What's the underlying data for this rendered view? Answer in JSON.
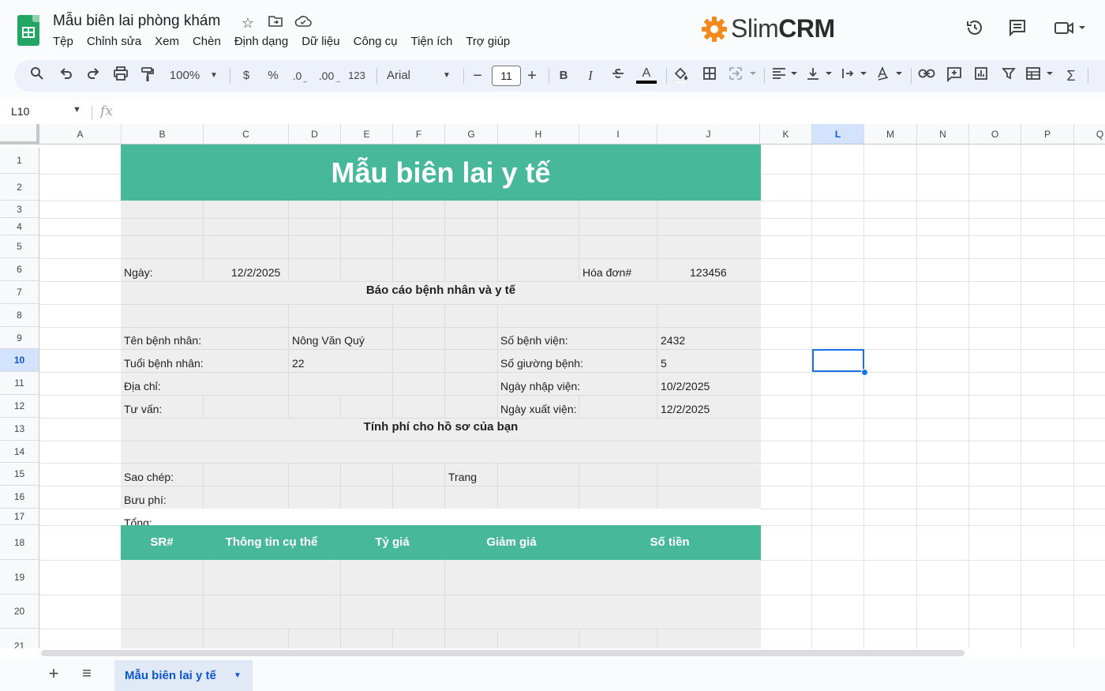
{
  "header": {
    "doc_title": "Mẫu biên lai phòng khám",
    "menus": [
      "Tệp",
      "Chỉnh sửa",
      "Xem",
      "Chèn",
      "Định dạng",
      "Dữ liệu",
      "Công cụ",
      "Tiện ích",
      "Trợ giúp"
    ],
    "brand_prefix": "Slim",
    "brand_bold": "CRM"
  },
  "toolbar": {
    "zoom": "100%",
    "currency": "$",
    "percent": "%",
    "dec_decrease": ".0",
    "dec_increase": ".00",
    "number_format": "123",
    "font": "Arial",
    "font_size": "11",
    "bold": "B",
    "italic": "I",
    "text_color": "A"
  },
  "formula_bar": {
    "cell_ref": "L10",
    "fx": "fx"
  },
  "columns": [
    "A",
    "B",
    "C",
    "D",
    "E",
    "F",
    "G",
    "H",
    "I",
    "J",
    "K",
    "L",
    "M",
    "N",
    "O",
    "P",
    "Q"
  ],
  "selected_column": "L",
  "rows": [
    "1",
    "2",
    "3",
    "4",
    "5",
    "6",
    "7",
    "8",
    "9",
    "10",
    "11",
    "12",
    "13",
    "14",
    "15",
    "16",
    "17",
    "18",
    "19",
    "20",
    "21"
  ],
  "selected_row": "10",
  "sheet": {
    "title": "Mẫu biên lai y tế",
    "date_label": "Ngày:",
    "date_value": "12/2/2025",
    "invoice_label": "Hóa đơn#",
    "invoice_value": "123456",
    "section1_title": "Báo cáo bệnh nhân và y tế",
    "patient_name_label": "Tên bệnh nhân:",
    "patient_name_value": "Nông Văn Quý",
    "patient_age_label": "Tuổi bệnh nhân:",
    "patient_age_value": "22",
    "address_label": "Địa chỉ:",
    "consult_label": "Tư vấn:",
    "hospital_no_label": "Số bệnh viện:",
    "hospital_no_value": "2432",
    "bed_no_label": "Số giường bệnh:",
    "bed_no_value": "5",
    "admit_label": "Ngày nhập viện:",
    "admit_value": "10/2/2025",
    "discharge_label": "Ngày xuất viện:",
    "discharge_value": "12/2/2025",
    "section2_title": "Tính phí cho hồ sơ của bạn",
    "copy_label": "Sao chép:",
    "page_label": "Trang",
    "postage_label": "Bưu phí:",
    "total_label": "Tổng:",
    "table_headers": [
      "SR#",
      "Thông tin cụ thể",
      "Tỷ giá",
      "Giảm giá",
      "Số tiền"
    ]
  },
  "tabs": {
    "active_sheet": "Mẫu biên lai y tế"
  },
  "colors": {
    "accent_green": "#48b89a",
    "selection_blue": "#1a73e8"
  }
}
